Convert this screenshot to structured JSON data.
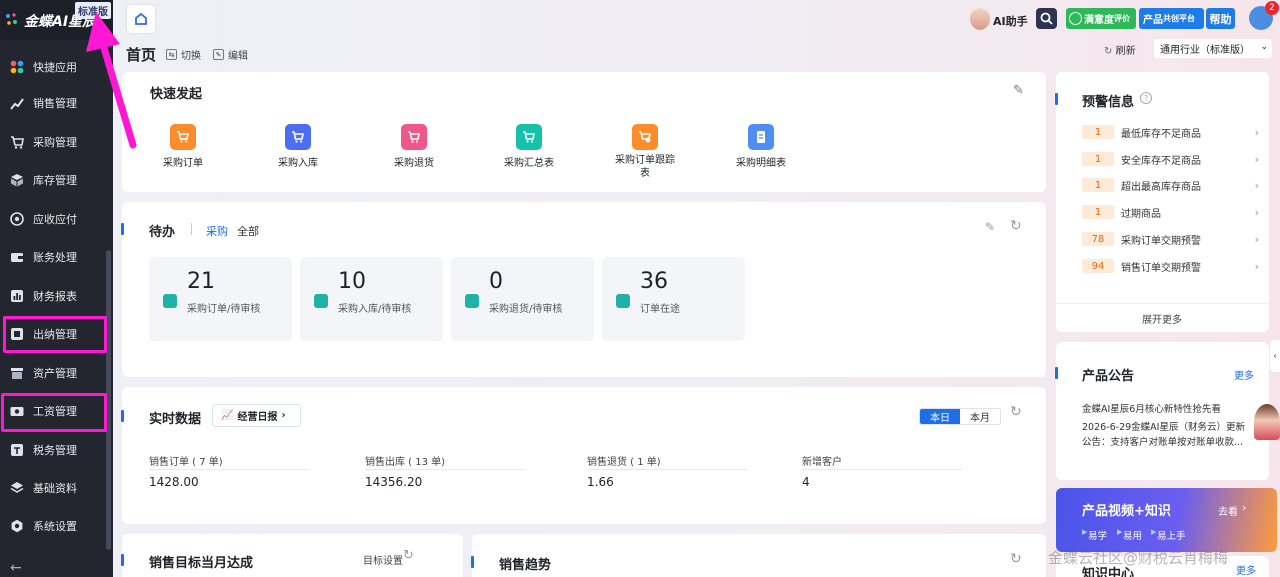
{
  "app": {
    "logo_text": "金蝶AI星辰",
    "edition_badge": "标准版"
  },
  "sidebar": {
    "items": [
      {
        "label": "快捷应用",
        "icon": "apps-icon"
      },
      {
        "label": "销售管理",
        "icon": "sales-chart-icon"
      },
      {
        "label": "采购管理",
        "icon": "cart-icon"
      },
      {
        "label": "库存管理",
        "icon": "box-icon"
      },
      {
        "label": "应收应付",
        "icon": "ledger-icon"
      },
      {
        "label": "账务处理",
        "icon": "wallet-icon"
      },
      {
        "label": "财务报表",
        "icon": "report-icon"
      },
      {
        "label": "出纳管理",
        "icon": "cashier-icon"
      },
      {
        "label": "资产管理",
        "icon": "asset-icon"
      },
      {
        "label": "工资管理",
        "icon": "salary-icon"
      },
      {
        "label": "税务管理",
        "icon": "tax-icon"
      },
      {
        "label": "基础资料",
        "icon": "layers-icon"
      },
      {
        "label": "系统设置",
        "icon": "gear-icon"
      }
    ]
  },
  "topbar": {
    "ai_label": "AI助手",
    "satisfaction": "满意度",
    "satisfaction_sub": "评价",
    "cobuild": "产品",
    "cobuild_sub": "共创平台",
    "help": "帮助",
    "notification_count": "2"
  },
  "page": {
    "title": "首页",
    "switch": "切换",
    "edit": "编辑",
    "refresh": "刷新",
    "industry": "通用行业（标准版）"
  },
  "quick": {
    "title": "快速发起",
    "items": [
      {
        "label": "采购订单",
        "color": "#fa8c2c"
      },
      {
        "label": "采购入库",
        "color": "#4e6ef2"
      },
      {
        "label": "采购退货",
        "color": "#f0568a"
      },
      {
        "label": "采购汇总表",
        "color": "#13c2a8"
      },
      {
        "label": "采购订单跟踪表",
        "color": "#fa8c2c"
      },
      {
        "label": "采购明细表",
        "color": "#4e8ef2"
      }
    ]
  },
  "todo": {
    "title": "待办",
    "tab_active": "采购",
    "tab_all": "全部",
    "items": [
      {
        "num": "21",
        "label": "采购订单/待审核"
      },
      {
        "num": "10",
        "label": "采购入库/待审核"
      },
      {
        "num": "0",
        "label": "采购退货/待审核"
      },
      {
        "num": "36",
        "label": "订单在途"
      }
    ]
  },
  "realtime": {
    "title": "实时数据",
    "report_btn": "经营日报",
    "seg_day": "本日",
    "seg_month": "本月",
    "metrics": [
      {
        "label": "销售订单 ( 7 单)",
        "value": "1428.00"
      },
      {
        "label": "销售出库 ( 13 单)",
        "value": "14356.20"
      },
      {
        "label": "销售退货 ( 1 单)",
        "value": "1.66"
      },
      {
        "label": "新增客户",
        "value": "4"
      }
    ]
  },
  "target": {
    "title": "销售目标当月达成",
    "setting": "目标设置"
  },
  "trend": {
    "title": "销售趋势"
  },
  "warning": {
    "title": "预警信息",
    "items": [
      {
        "count": "1",
        "label": "最低库存不足商品"
      },
      {
        "count": "1",
        "label": "安全库存不足商品"
      },
      {
        "count": "1",
        "label": "超出最高库存商品"
      },
      {
        "count": "1",
        "label": "过期商品"
      },
      {
        "count": "78",
        "label": "采购订单交期预警"
      },
      {
        "count": "94",
        "label": "销售订单交期预警"
      }
    ],
    "expand": "展开更多"
  },
  "notice": {
    "title": "产品公告",
    "more": "更多",
    "lines": [
      "金蝶AI星辰6月核心新特性抢先看",
      "2026-6-29金蝶AI星辰（财务云）更新",
      "公告：支持客户对账单按对账单收款..."
    ]
  },
  "video": {
    "title": "产品视频+知识",
    "go": "去看",
    "tags": [
      "易学",
      "易用",
      "易上手"
    ]
  },
  "knowledge": {
    "title": "知识中心",
    "more": "更多"
  },
  "watermark": "金蝶云社区@财税云肖梅梅"
}
